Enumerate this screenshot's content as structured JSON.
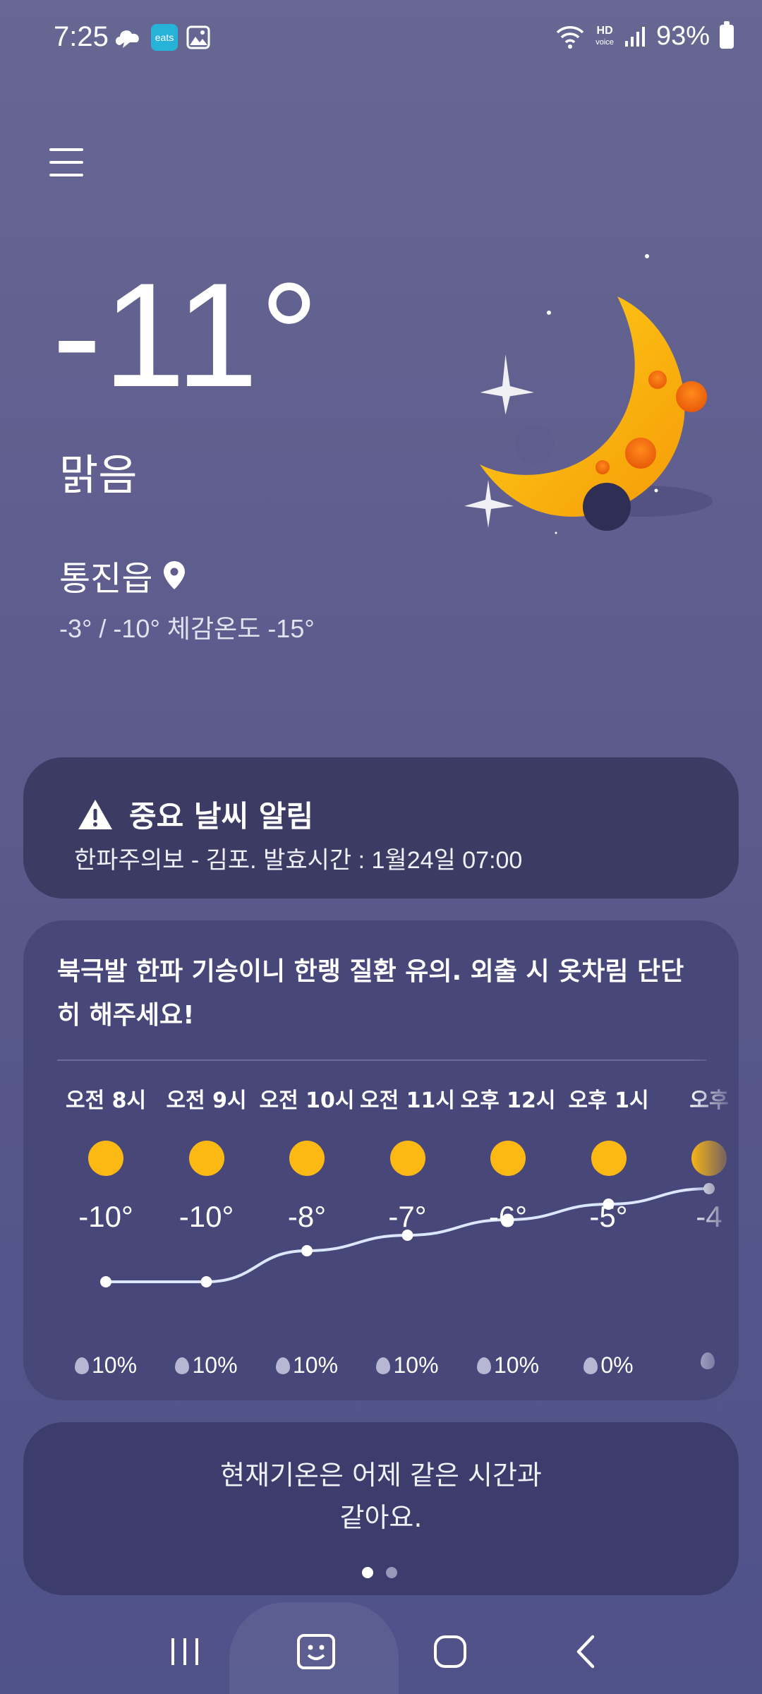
{
  "status_bar": {
    "time": "7:25",
    "left_icons": [
      "cloud-icon",
      "eats-app-icon",
      "gallery-icon"
    ],
    "eats_label": "eats",
    "hd_top": "HD",
    "hd_bottom": "voice",
    "battery": "93%"
  },
  "current": {
    "temperature": "-11°",
    "condition": "맑음",
    "location": "통진읍",
    "range": "-3° / -10° 체감온도 -15°"
  },
  "alert": {
    "title": "중요 날씨 알림",
    "text": "한파주의보 - 김포. 발효시간 : 1월24일 07:00"
  },
  "hourly": {
    "message": "북극발 한파 기승이니 한랭 질환 유의. 외출 시 옷차림 단단히 해주세요!",
    "items": [
      {
        "time": "오전 8시",
        "temp": "-10°",
        "precip": "10%"
      },
      {
        "time": "오전 9시",
        "temp": "-10°",
        "precip": "10%"
      },
      {
        "time": "오전 10시",
        "temp": "-8°",
        "precip": "10%"
      },
      {
        "time": "오전 11시",
        "temp": "-7°",
        "precip": "10%"
      },
      {
        "time": "오후 12시",
        "temp": "-6°",
        "precip": "10%"
      },
      {
        "time": "오후 1시",
        "temp": "-5°",
        "precip": "0%"
      },
      {
        "time": "오후",
        "temp": "-4",
        "precip": ""
      }
    ],
    "graph_values": [
      -10,
      -10,
      -8,
      -7,
      -6,
      -5,
      -4
    ]
  },
  "comparison": {
    "line1": "현재기온은 어제 같은 시간과",
    "line2": "같아요.",
    "page_count": 2,
    "active_page": 0
  },
  "colors": {
    "sun": "#fdb913",
    "moon": "#fdb913",
    "card_dark": "#3b3b64"
  }
}
